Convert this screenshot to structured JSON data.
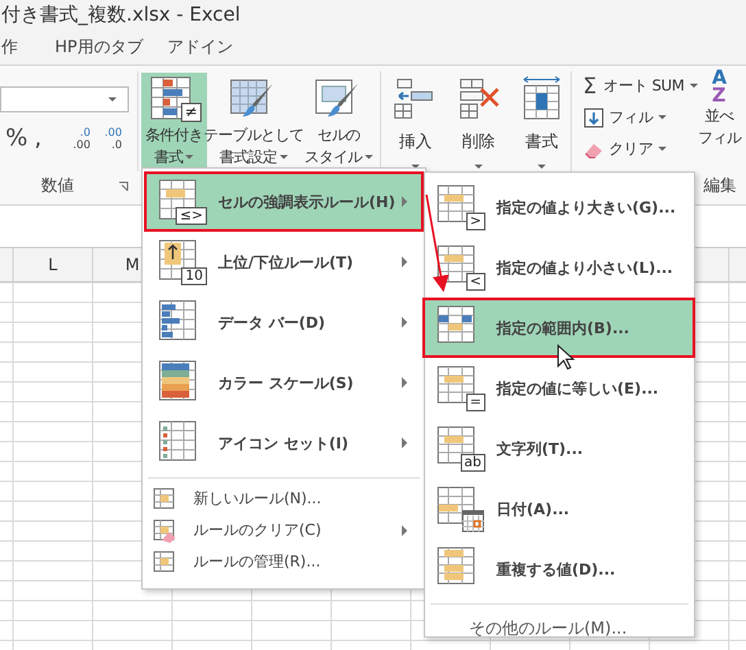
{
  "window": {
    "title": "付き書式_複数.xlsx - Excel"
  },
  "tabs": [
    {
      "label": "作"
    },
    {
      "label": "HP用のタブ"
    },
    {
      "label": "アドイン"
    }
  ],
  "ribbon": {
    "number": {
      "label": "数値",
      "symbols": [
        "%",
        ","
      ],
      "decimal_buttons": [
        {
          "lines": [
            ".0",
            ".00"
          ]
        },
        {
          "lines": [
            ".00",
            ".0"
          ]
        }
      ]
    },
    "styles": [
      {
        "lines": [
          "条件付き",
          "書式"
        ],
        "badge": "≠",
        "selected": true
      },
      {
        "lines": [
          "テーブルとして",
          "書式設定"
        ],
        "selected": false
      },
      {
        "lines": [
          "セルの",
          "スタイル"
        ],
        "selected": false
      }
    ],
    "cells": [
      {
        "label": "挿入"
      },
      {
        "label": "削除"
      },
      {
        "label": "書式"
      }
    ],
    "editing": {
      "label": "編集",
      "items": [
        {
          "glyph": "Σ",
          "label": "オート SUM"
        },
        {
          "label": "フィル"
        },
        {
          "label": "クリア"
        }
      ],
      "sort": {
        "letters": [
          "A",
          "Z"
        ],
        "lines": [
          "並べ",
          "フィル"
        ]
      }
    }
  },
  "columns": [
    "L",
    "M"
  ],
  "menu": {
    "items": [
      {
        "kind": "large",
        "label": "セルの強調表示ルール(H)",
        "badge": "≤>",
        "submenu": true,
        "selected": true
      },
      {
        "kind": "large",
        "label": "上位/下位ルール(T)",
        "badge": "10",
        "submenu": true,
        "selected": false
      },
      {
        "kind": "large",
        "label": "データ バー(D)",
        "submenu": true,
        "selected": false
      },
      {
        "kind": "large",
        "label": "カラー スケール(S)",
        "submenu": true,
        "selected": false
      },
      {
        "kind": "large",
        "label": "アイコン セット(I)",
        "submenu": true,
        "selected": false
      },
      {
        "kind": "small",
        "label": "新しいルール(N)...",
        "submenu": false,
        "selected": false
      },
      {
        "kind": "small",
        "label": "ルールのクリア(C)",
        "submenu": true,
        "selected": false
      },
      {
        "kind": "small",
        "label": "ルールの管理(R)...",
        "submenu": false,
        "selected": false
      }
    ]
  },
  "submenu": {
    "items": [
      {
        "label": "指定の値より大きい(G)...",
        "badge": ">",
        "selected": false
      },
      {
        "label": "指定の値より小さい(L)...",
        "badge": "<",
        "selected": false
      },
      {
        "label": "指定の範囲内(B)...",
        "selected": true
      },
      {
        "label": "指定の値に等しい(E)...",
        "badge": "=",
        "selected": false
      },
      {
        "label": "文字列(T)...",
        "badge": "ab",
        "selected": false
      },
      {
        "label": "日付(A)...",
        "selected": false
      },
      {
        "label": "重複する値(D)...",
        "selected": false
      }
    ],
    "more": "その他のルール(M)..."
  }
}
